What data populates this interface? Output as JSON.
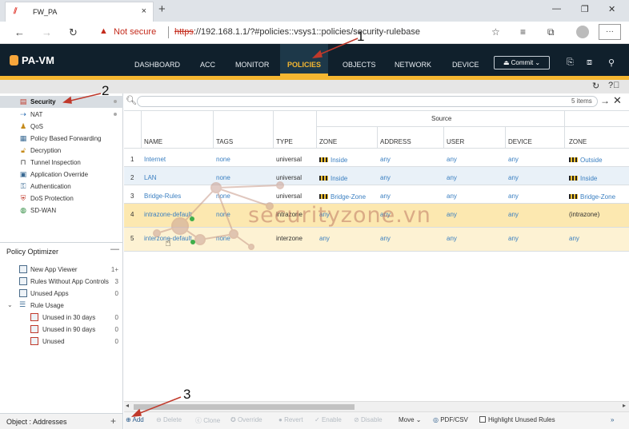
{
  "browser": {
    "tab_title": "FW_PA",
    "tab_close": "×",
    "new_tab": "+",
    "not_secure": "Not secure",
    "url_scheme": "https",
    "url_rest": "://192.168.1.1/?#policies::vsys1::policies/security-rulebase"
  },
  "app": {
    "logo": "PA-VM",
    "menu": [
      "DASHBOARD",
      "ACC",
      "MONITOR",
      "POLICIES",
      "OBJECTS",
      "NETWORK",
      "DEVICE"
    ],
    "active_menu": "POLICIES",
    "commit_label": "Commit"
  },
  "left_nav": {
    "items": [
      "Security",
      "NAT",
      "QoS",
      "Policy Based Forwarding",
      "Decryption",
      "Tunnel Inspection",
      "Application Override",
      "Authentication",
      "DoS Protection",
      "SD-WAN"
    ],
    "selected": "Security"
  },
  "optimizer": {
    "title": "Policy Optimizer",
    "items": [
      {
        "label": "New App Viewer",
        "count": "1+"
      },
      {
        "label": "Rules Without App Controls",
        "count": "3"
      },
      {
        "label": "Unused Apps",
        "count": "0"
      },
      {
        "label": "Rule Usage",
        "count": ""
      },
      {
        "label": "Unused in 30 days",
        "count": "0"
      },
      {
        "label": "Unused in 90 days",
        "count": "0"
      },
      {
        "label": "Unused",
        "count": "0"
      }
    ]
  },
  "left_footer": {
    "label": "Object : Addresses",
    "plus": "+"
  },
  "search": {
    "items_count": "5 items",
    "go": "→",
    "clear": "✕"
  },
  "table": {
    "group_source": "Source",
    "headers": [
      "NAME",
      "TAGS",
      "TYPE",
      "ZONE",
      "ADDRESS",
      "USER",
      "DEVICE",
      "ZONE"
    ],
    "rows": [
      {
        "num": "1",
        "name": "Internet",
        "tags": "none",
        "type": "universal",
        "src_zone": "Inside",
        "address": "any",
        "user": "any",
        "device": "any",
        "dst_zone": "Outside"
      },
      {
        "num": "2",
        "name": "LAN",
        "tags": "none",
        "type": "universal",
        "src_zone": "Inside",
        "address": "any",
        "user": "any",
        "device": "any",
        "dst_zone": "Inside"
      },
      {
        "num": "3",
        "name": "Bridge-Rules",
        "tags": "none",
        "type": "universal",
        "src_zone": "Bridge-Zone",
        "address": "any",
        "user": "any",
        "device": "any",
        "dst_zone": "Bridge-Zone"
      },
      {
        "num": "4",
        "name": "intrazone-default",
        "tags": "none",
        "type": "intrazone",
        "src_zone": "any",
        "address": "any",
        "user": "any",
        "device": "any",
        "dst_zone": "(intrazone)"
      },
      {
        "num": "5",
        "name": "interzone-default",
        "tags": "none",
        "type": "interzone",
        "src_zone": "any",
        "address": "any",
        "user": "any",
        "device": "any",
        "dst_zone": "any"
      }
    ]
  },
  "actions": {
    "add": "Add",
    "delete": "Delete",
    "clone": "Clone",
    "override": "Override",
    "revert": "Revert",
    "enable": "Enable",
    "disable": "Disable",
    "move": "Move",
    "pdf_csv": "PDF/CSV",
    "highlight": "Highlight Unused Rules",
    "more": "»"
  },
  "annotations": {
    "one": "1",
    "two": "2",
    "three": "3"
  },
  "watermark": "securityzone.vn",
  "colors": {
    "header_bg": "#10202c",
    "accent": "#f5b731",
    "link": "#3a7fc1",
    "row_blue": "#e9f1f8",
    "row_yellow": "#fce8b0"
  }
}
